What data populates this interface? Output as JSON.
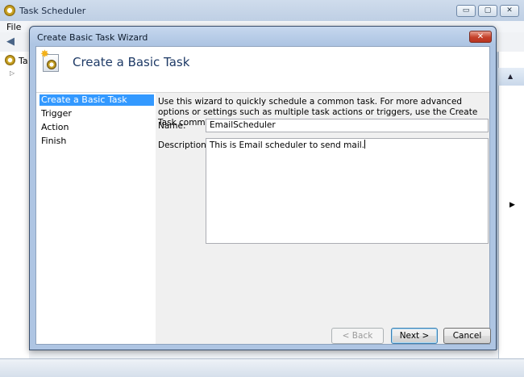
{
  "background_window": {
    "title": "Task Scheduler",
    "menu_visible": "File",
    "tree_root_label": "Ta",
    "caption_buttons": {
      "minimize": "▭",
      "maximize": "▢",
      "close": "✕"
    }
  },
  "dialog": {
    "title": "Create Basic Task Wizard",
    "close_glyph": "✕",
    "header_title": "Create a Basic Task",
    "nav": [
      "Create a Basic Task",
      "Trigger",
      "Action",
      "Finish"
    ],
    "selected_nav_index": 0,
    "intro_text": "Use this wizard to quickly schedule a common task.  For more advanced options or settings such as multiple task actions or triggers, use the Create Task command in the Actions pane.",
    "name_label": "Name:",
    "name_value": "EmailScheduler",
    "description_label": "Description:",
    "description_value": "This is Email scheduler to send mail.",
    "buttons": {
      "back": "< Back",
      "next": "Next >",
      "cancel": "Cancel"
    }
  },
  "icons": [
    "task-scheduler-icon",
    "back-arrow-icon",
    "wizard-task-icon",
    "close-icon",
    "expand-arrow-icon"
  ]
}
